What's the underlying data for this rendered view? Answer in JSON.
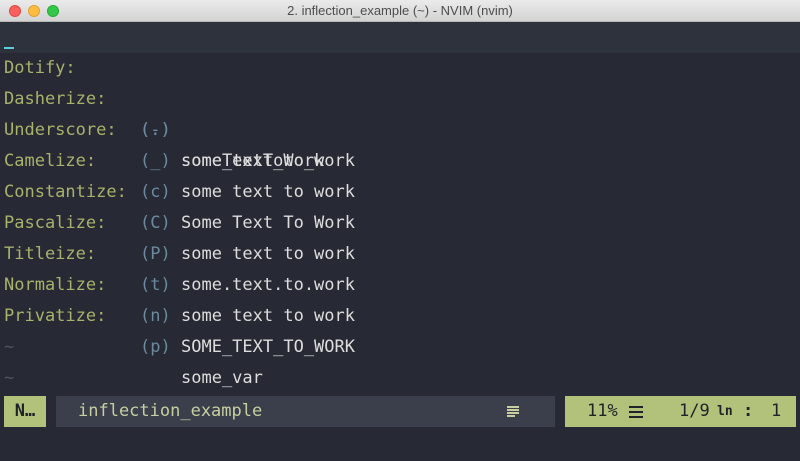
{
  "window": {
    "title": "2. inflection_example (~) - NVIM (nvim)"
  },
  "buffer": {
    "lines": [
      {
        "key": "Dotify:",
        "abbr": "(.)",
        "value": "someTextToWork"
      },
      {
        "key": "Dasherize:",
        "abbr": "(-)",
        "value": "some_text_to_work"
      },
      {
        "key": "Underscore:",
        "abbr": "(_)",
        "value": "some text to work"
      },
      {
        "key": "Camelize:",
        "abbr": "(c)",
        "value": "Some Text To Work"
      },
      {
        "key": "Constantize:",
        "abbr": "(C)",
        "value": "some text to work"
      },
      {
        "key": "Pascalize:",
        "abbr": "(P)",
        "value": "some.text.to.work"
      },
      {
        "key": "Titleize:",
        "abbr": "(t)",
        "value": "some text to work"
      },
      {
        "key": "Normalize:",
        "abbr": "(n)",
        "value": "SOME_TEXT_TO_WORK"
      },
      {
        "key": "Privatize:",
        "abbr": "(p)",
        "value": "some_var"
      }
    ],
    "tilde": "~"
  },
  "statusline": {
    "mode": "N…",
    "filename": "inflection_example",
    "fileformat_icon": "lines-icon",
    "percent": "11%",
    "position_icon": "menu-icon",
    "line": "1/9",
    "line_icon": "ln",
    "colon": ":",
    "column": "1"
  },
  "colors": {
    "background": "#272a34",
    "key": "#a7b26a",
    "abbr": "#6b8aa0",
    "value": "#dddddd",
    "statusline_accent": "#b2c27b",
    "cursor": "#5ad0dc"
  }
}
